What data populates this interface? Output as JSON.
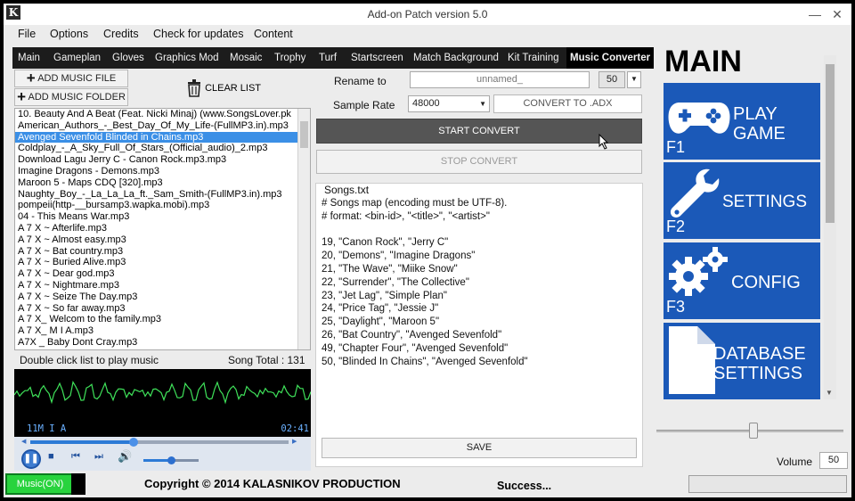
{
  "window": {
    "title": "Add-on Patch version 5.0",
    "logo": "K",
    "minimize": "—",
    "close": "✕"
  },
  "menu": [
    "File",
    "Options",
    "Credits",
    "Check for updates",
    "Content"
  ],
  "tabs": [
    "Main",
    "Gameplan",
    "Gloves",
    "Graphics Mod",
    "Mosaic",
    "Trophy",
    "Turf",
    "Startscreen",
    "Match Background",
    "Kit Training",
    "Music Converter"
  ],
  "active_tab": "Music Converter",
  "buttons": {
    "add_file": "ADD MUSIC FILE",
    "add_folder": "ADD MUSIC FOLDER",
    "clear": "CLEAR LIST",
    "start": "START CONVERT",
    "stop": "STOP CONVERT",
    "convert_adx": "CONVERT TO .ADX",
    "save": "SAVE"
  },
  "playlist": [
    "10. Beauty And A Beat (Feat. Nicki Minaj) (www.SongsLover.pk",
    "American_Authors_-_Best_Day_Of_My_Life-(FullMP3.in).mp3",
    "Avenged Sevenfold Blinded in Chains.mp3",
    "Coldplay_-_A_Sky_Full_Of_Stars_(Official_audio)_2.mp3",
    "Download Lagu Jerry C - Canon Rock.mp3.mp3",
    "Imagine Dragons - Demons.mp3",
    "Maroon 5 - Maps CDQ [320].mp3",
    "Naughty_Boy_-_La_La_La_ft._Sam_Smith-(FullMP3.in).mp3",
    "pompeii(http-__bursamp3.wapka.mobi).mp3",
    "04 - This Means War.mp3",
    "A 7 X ~ Afterlife.mp3",
    "A 7 X ~ Almost easy.mp3",
    "A 7 X ~ Bat country.mp3",
    "A 7 X ~ Buried Alive.mp3",
    "A 7 X ~ Dear god.mp3",
    "A 7 X ~ Nightmare.mp3",
    "A 7 X ~ Seize The Day.mp3",
    "A 7 X ~ So far away.mp3",
    "A 7 X_ Welcom to the family.mp3",
    "A 7 X_ M I A.mp3",
    "A7X _ Baby Dont Cray.mp3"
  ],
  "selected_index": 2,
  "hint": "Double click list to play music",
  "song_total": "Song Total : 131",
  "player": {
    "track": "11M I A",
    "time": "02:41",
    "progress": 0.4,
    "volume": 0.5
  },
  "converter": {
    "rename_label": "Rename to",
    "rename_value": "unnamed_",
    "rename_count": "50",
    "rate_label": "Sample Rate",
    "rate_value": "48000",
    "songs_label": "Songs.txt",
    "songs_text": "# Songs map (encoding must be UTF-8).\n# format: <bin-id>, \"<title>\", \"<artist>\"\n\n19, \"Canon Rock\", \"Jerry C\"\n20, \"Demons\", \"Imagine Dragons\"\n21, \"The Wave\", \"Miike Snow\"\n22, \"Surrender\", \"The Collective\"\n23, \"Jet Lag\", \"Simple Plan\"\n24, \"Price Tag\", \"Jessie J\"\n25, \"Daylight\", \"Maroon 5\"\n26, \"Bat Country\", \"Avenged Sevenfold\"\n49, \"Chapter Four\", \"Avenged Sevenfold\"\n50, \"Blinded In Chains\", \"Avenged Sevenfold\""
  },
  "sidebar": {
    "title": "MAIN",
    "tiles": [
      {
        "line1": "PLAY",
        "line2": "GAME",
        "key": "F1",
        "icon": "gamepad-icon"
      },
      {
        "line1": "SETTINGS",
        "line2": "",
        "key": "F2",
        "icon": "wrench-icon"
      },
      {
        "line1": "CONFIG",
        "line2": "",
        "key": "F3",
        "icon": "gears-icon"
      },
      {
        "line1": "DATABASE",
        "line2": "SETTINGS",
        "key": "",
        "icon": "document-icon"
      }
    ],
    "volume_label": "Volume",
    "volume_value": "50"
  },
  "footer": {
    "music": "Music(ON)",
    "copyright": "Copyright ©  2014 KALASNIKOV PRODUCTION",
    "status": "Success..."
  },
  "colors": {
    "tile_blue": "#1b59b8",
    "tab_bg": "#1c1c1c",
    "music_green": "#28d33d",
    "selection": "#3b8fe6"
  }
}
